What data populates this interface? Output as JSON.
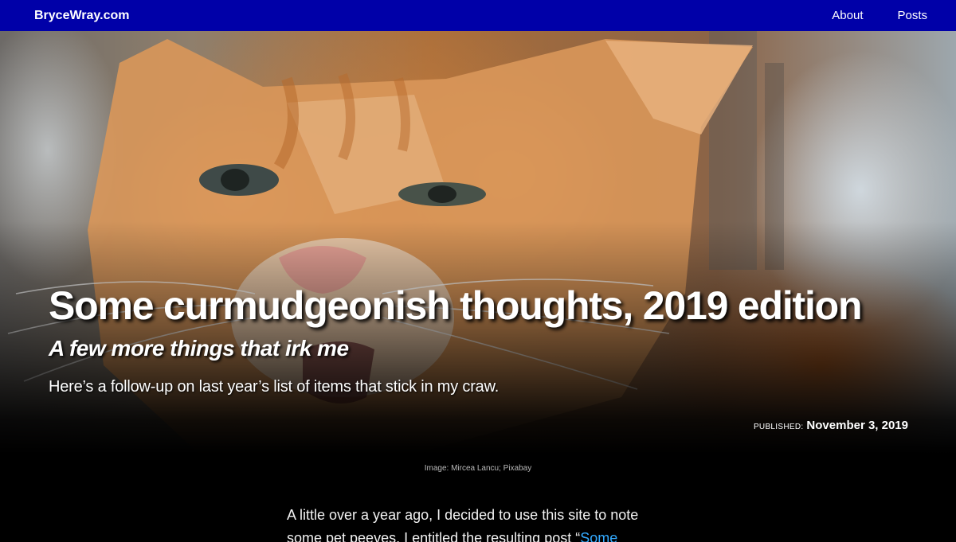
{
  "nav": {
    "site_title": "BryceWray.com",
    "links": [
      "About",
      "Posts"
    ]
  },
  "hero": {
    "title": "Some curmudgeonish thoughts, 2019 edition",
    "subtitle": "A few more things that irk me",
    "description": "Here’s a follow-up on last year’s list of items that stick in my craw.",
    "published_label": "Published:",
    "published_date": "November 3, 2019",
    "image_caption": "Image: Mircea Lancu; Pixabay"
  },
  "article": {
    "intro_text": "A little over a year ago, I decided to use this site to note some pet peeves. I entitled the resulting post “",
    "link_text": "Some"
  },
  "colors": {
    "navbar": "#0000a8",
    "link": "#33aaff",
    "background": "#000000"
  }
}
